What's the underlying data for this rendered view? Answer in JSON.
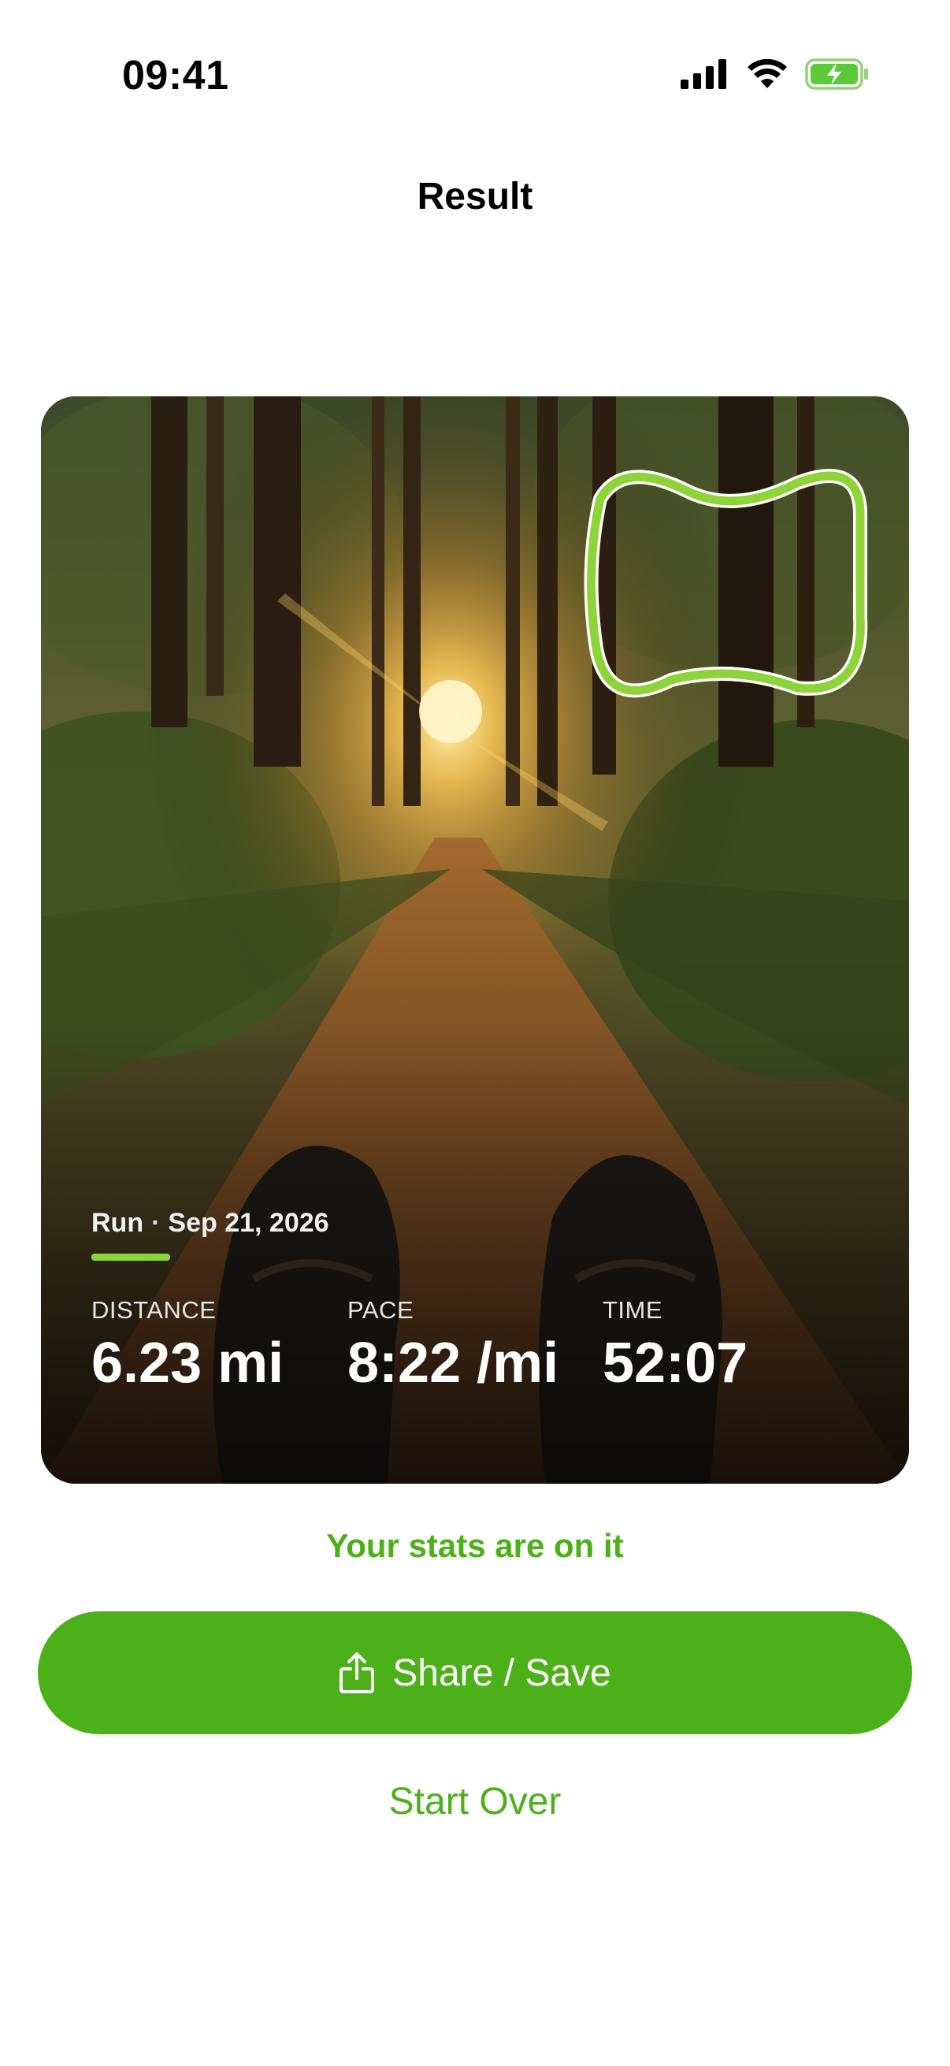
{
  "status_bar": {
    "time": "09:41"
  },
  "header": {
    "title": "Result"
  },
  "card": {
    "activity": "Run",
    "separator": "·",
    "date": "Sep 21, 2026",
    "stats": [
      {
        "label": "DISTANCE",
        "value": "6.23 mi"
      },
      {
        "label": "PACE",
        "value": "8:22 /mi"
      },
      {
        "label": "TIME",
        "value": "52:07"
      }
    ],
    "accent_color": "#8fd33a"
  },
  "caption": "Your stats are on it",
  "share_button": {
    "label": "Share / Save",
    "icon": "share-icon"
  },
  "start_over_label": "Start Over",
  "colors": {
    "brand_green": "#4cb019",
    "outline_green": "#8fd33a"
  }
}
